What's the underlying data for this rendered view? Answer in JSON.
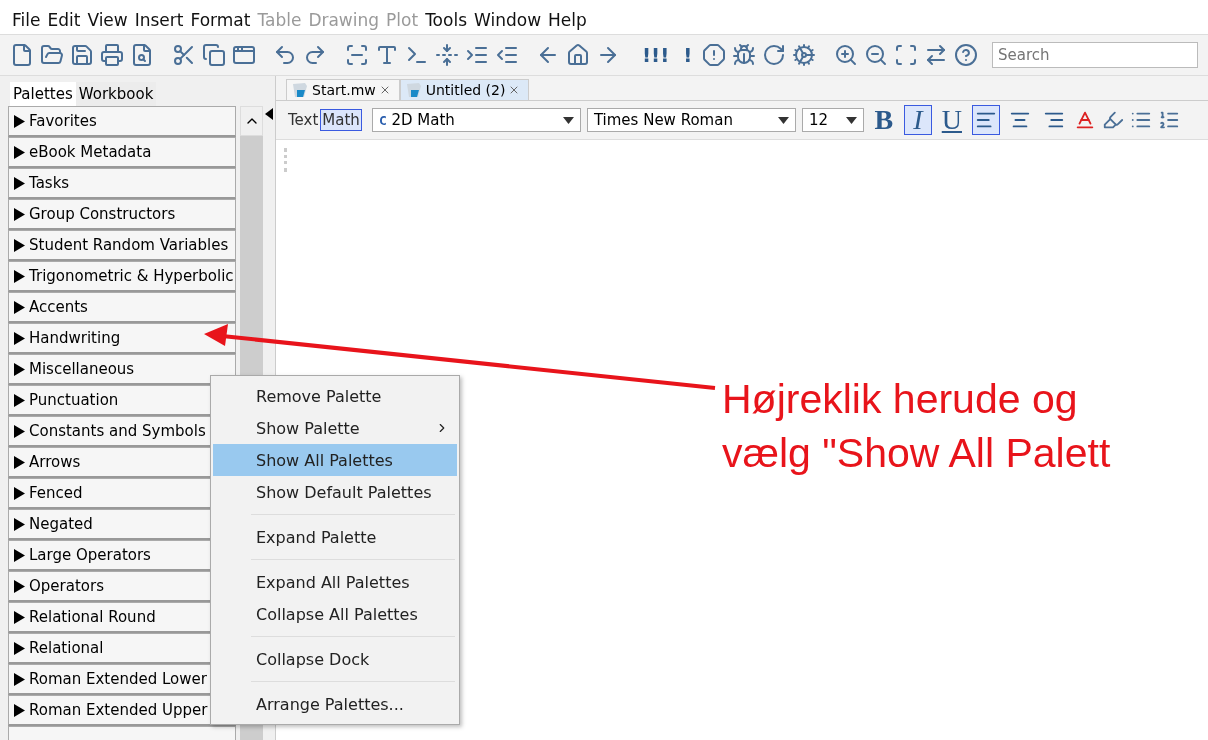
{
  "menu_bar": [
    {
      "label": "File",
      "disabled": false
    },
    {
      "label": "Edit",
      "disabled": false
    },
    {
      "label": "View",
      "disabled": false
    },
    {
      "label": "Insert",
      "disabled": false
    },
    {
      "label": "Format",
      "disabled": false
    },
    {
      "label": "Table",
      "disabled": true
    },
    {
      "label": "Drawing",
      "disabled": true
    },
    {
      "label": "Plot",
      "disabled": true
    },
    {
      "label": "Tools",
      "disabled": false
    },
    {
      "label": "Window",
      "disabled": false
    },
    {
      "label": "Help",
      "disabled": false
    }
  ],
  "toolbar": {
    "glyph_buttons": [
      "!!!",
      "!"
    ],
    "search": {
      "placeholder": "Search"
    }
  },
  "dock_tabs": [
    {
      "label": "Palettes",
      "selected": true
    },
    {
      "label": "Workbook",
      "selected": false
    }
  ],
  "palettes": [
    "Favorites",
    "eBook Metadata",
    "Tasks",
    "Group Constructors",
    "Student Random Variables",
    "Trigonometric & Hyperbolic",
    "Accents",
    "Handwriting",
    "Miscellaneous",
    "Punctuation",
    "Constants and Symbols",
    "Arrows",
    "Fenced",
    "Negated",
    "Large Operators",
    "Operators",
    "Relational Round",
    "Relational",
    "Roman Extended Lower",
    "Roman Extended Upper"
  ],
  "document_tabs": [
    {
      "label": "Start.mw",
      "selected": false
    },
    {
      "label": "Untitled (2)",
      "selected": true
    }
  ],
  "format_bar": {
    "modes": [
      {
        "label": "Text",
        "selected": false
      },
      {
        "label": "Math",
        "selected": true
      }
    ],
    "style_prefix": "C",
    "style": "2D Math",
    "font": "Times New Roman",
    "size": "12",
    "text_styles": [
      {
        "label": "B",
        "kind": "bold",
        "on": false
      },
      {
        "label": "I",
        "kind": "italic",
        "on": true
      },
      {
        "label": "U",
        "kind": "underline",
        "on": false
      }
    ],
    "alignments": [
      {
        "kind": "left",
        "selected": true
      },
      {
        "kind": "center",
        "selected": false
      },
      {
        "kind": "right",
        "selected": false
      }
    ]
  },
  "context_menu": [
    {
      "label": "Remove Palette",
      "selected": false,
      "submenu": false,
      "separator_before": false
    },
    {
      "label": "Show Palette",
      "selected": false,
      "submenu": true,
      "separator_before": false
    },
    {
      "label": "Show All Palettes",
      "selected": true,
      "submenu": false,
      "separator_before": false
    },
    {
      "label": "Show Default Palettes",
      "selected": false,
      "submenu": false,
      "separator_before": false
    },
    {
      "label": "Expand Palette",
      "selected": false,
      "submenu": false,
      "separator_before": true
    },
    {
      "label": "Expand All Palettes",
      "selected": false,
      "submenu": false,
      "separator_before": true
    },
    {
      "label": "Collapse All Palettes",
      "selected": false,
      "submenu": false,
      "separator_before": false
    },
    {
      "label": "Collapse Dock",
      "selected": false,
      "submenu": false,
      "separator_before": true
    },
    {
      "label": "Arrange Palettes...",
      "selected": false,
      "submenu": false,
      "separator_before": true
    }
  ],
  "annotation": {
    "lines": [
      "Højreklik herude og",
      "vælg \"Show All Palett"
    ]
  }
}
